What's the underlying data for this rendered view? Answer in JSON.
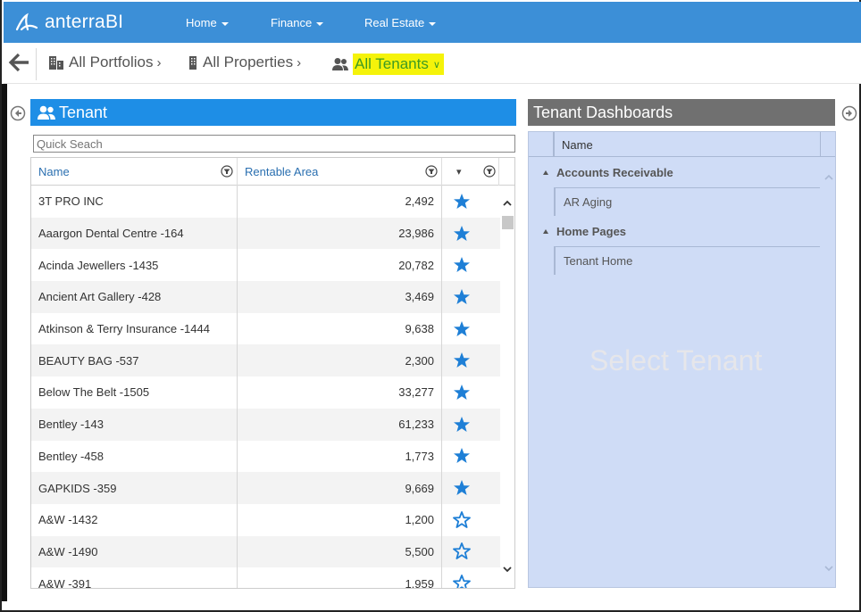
{
  "app": {
    "brand": "anterraBI",
    "accent": "#3c8fd7"
  },
  "nav": [
    {
      "label": "Home"
    },
    {
      "label": "Finance"
    },
    {
      "label": "Real Estate"
    }
  ],
  "breadcrumb": {
    "portfolios": "All Portfolios",
    "properties": "All Properties",
    "tenants": "All Tenants"
  },
  "tenant_panel": {
    "title": "Tenant",
    "search_placeholder": "Quick Seach",
    "columns": {
      "name": "Name",
      "area": "Rentable Area",
      "fav": "▾"
    },
    "rows": [
      {
        "name": "3T PRO INC",
        "area": "2,492",
        "fav": true
      },
      {
        "name": "Aaargon Dental Centre -164",
        "area": "23,986",
        "fav": true
      },
      {
        "name": "Acinda Jewellers -1435",
        "area": "20,782",
        "fav": true
      },
      {
        "name": "Ancient Art Gallery -428",
        "area": "3,469",
        "fav": true
      },
      {
        "name": "Atkinson & Terry Insurance -1444",
        "area": "9,638",
        "fav": true
      },
      {
        "name": "BEAUTY BAG -537",
        "area": "2,300",
        "fav": true
      },
      {
        "name": "Below The Belt -1505",
        "area": "33,277",
        "fav": true
      },
      {
        "name": "Bentley -143",
        "area": "61,233",
        "fav": true
      },
      {
        "name": "Bentley -458",
        "area": "1,773",
        "fav": true
      },
      {
        "name": "GAPKIDS -359",
        "area": "9,669",
        "fav": true
      },
      {
        "name": "A&W -1432",
        "area": "1,200",
        "fav": false
      },
      {
        "name": "A&W -1490",
        "area": "5,500",
        "fav": false
      },
      {
        "name": "A&W -391",
        "area": "1,959",
        "fav": false
      }
    ]
  },
  "dash_panel": {
    "title": "Tenant Dashboards",
    "column": "Name",
    "groups": [
      {
        "label": "Accounts Receivable",
        "items": [
          "AR Aging"
        ]
      },
      {
        "label": "Home Pages",
        "items": [
          "Tenant Home"
        ]
      }
    ],
    "empty_hint": "Select Tenant"
  },
  "icons": {
    "back": "arrow-left-icon",
    "portfolio": "buildings-icon",
    "property": "building-icon",
    "tenants": "users-icon",
    "star_filled": "star-filled-icon",
    "star_outline": "star-outline-icon"
  },
  "colors": {
    "star": "#1e7fd6",
    "highlight": "#f5f30a",
    "highlight_text": "#3d9b23"
  }
}
